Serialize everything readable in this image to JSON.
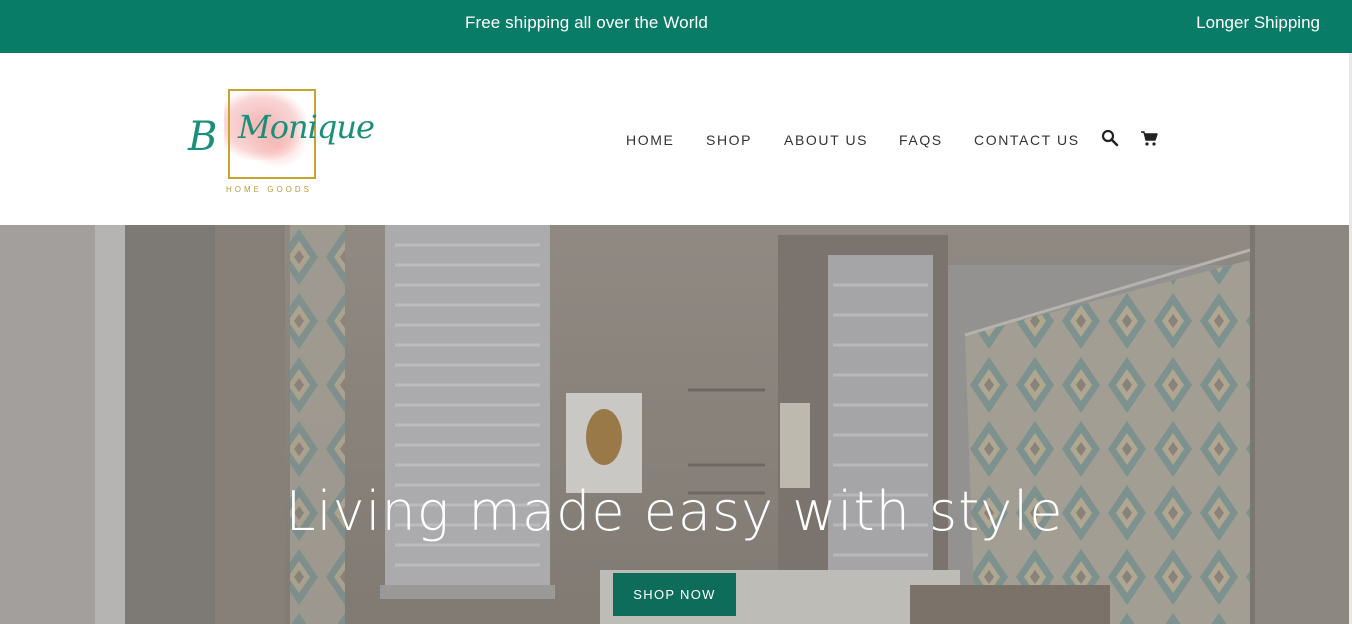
{
  "announcement": {
    "message": "Free shipping all over the World",
    "shipping_link": "Longer Shipping"
  },
  "logo": {
    "initial": "B",
    "name": "Monique",
    "subtitle": "HOME GOODS"
  },
  "nav": {
    "items": [
      {
        "label": "HOME"
      },
      {
        "label": "SHOP"
      },
      {
        "label": "ABOUT US"
      },
      {
        "label": "FAQS"
      },
      {
        "label": "CONTACT US"
      }
    ],
    "icons": [
      "search-icon",
      "cart-icon"
    ]
  },
  "hero": {
    "title": "Living made easy with style",
    "button_label": "SHOP NOW"
  },
  "colors": {
    "brand_green": "#087c66",
    "button_green": "#0d6d5a",
    "logo_teal": "#1c8f7b",
    "logo_gold": "#c8a32e"
  }
}
